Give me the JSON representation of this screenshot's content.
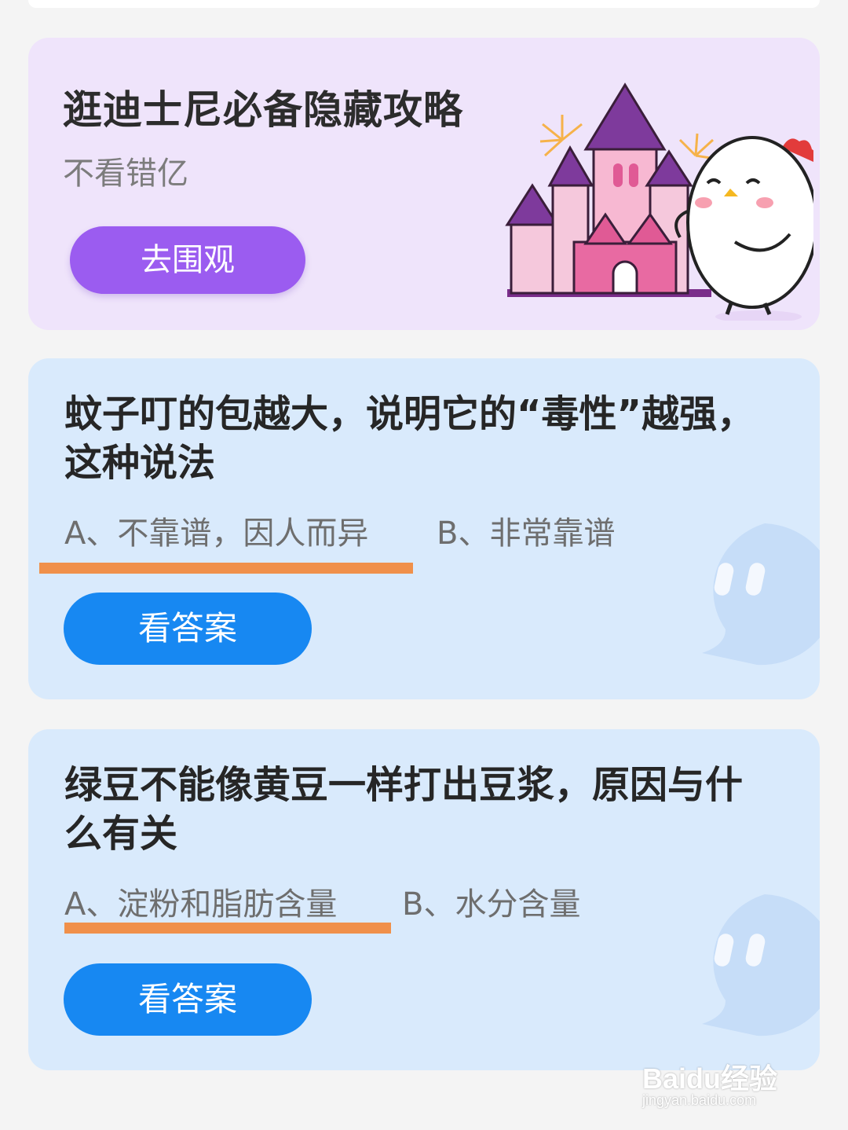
{
  "promo": {
    "title": "逛迪士尼必备隐藏攻略",
    "subtitle": "不看错亿",
    "button_label": "去围观"
  },
  "quizzes": [
    {
      "question": "蚊子叮的包越大，说明它的“毒性”越强，这种说法",
      "option_a": "A、不靠谱，因人而异",
      "option_b": "B、非常靠谱",
      "button_label": "看答案",
      "marked_option": "A"
    },
    {
      "question": "绿豆不能像黄豆一样打出豆浆，原因与什么有关",
      "option_a": "A、淀粉和脂肪含量",
      "option_b": "B、水分含量",
      "button_label": "看答案",
      "marked_option": "A"
    }
  ],
  "watermark": {
    "brand": "Baidu经验",
    "url": "jingyan.baidu.com"
  },
  "colors": {
    "promo_bg": "#efe4fb",
    "promo_button": "#9b5cf0",
    "quiz_bg": "#d9eafc",
    "answer_button": "#1788f2",
    "underline": "#f0904a"
  },
  "icons": [
    "castle-illustration",
    "chicken-mascot-icon",
    "chat-bubble-icon"
  ]
}
